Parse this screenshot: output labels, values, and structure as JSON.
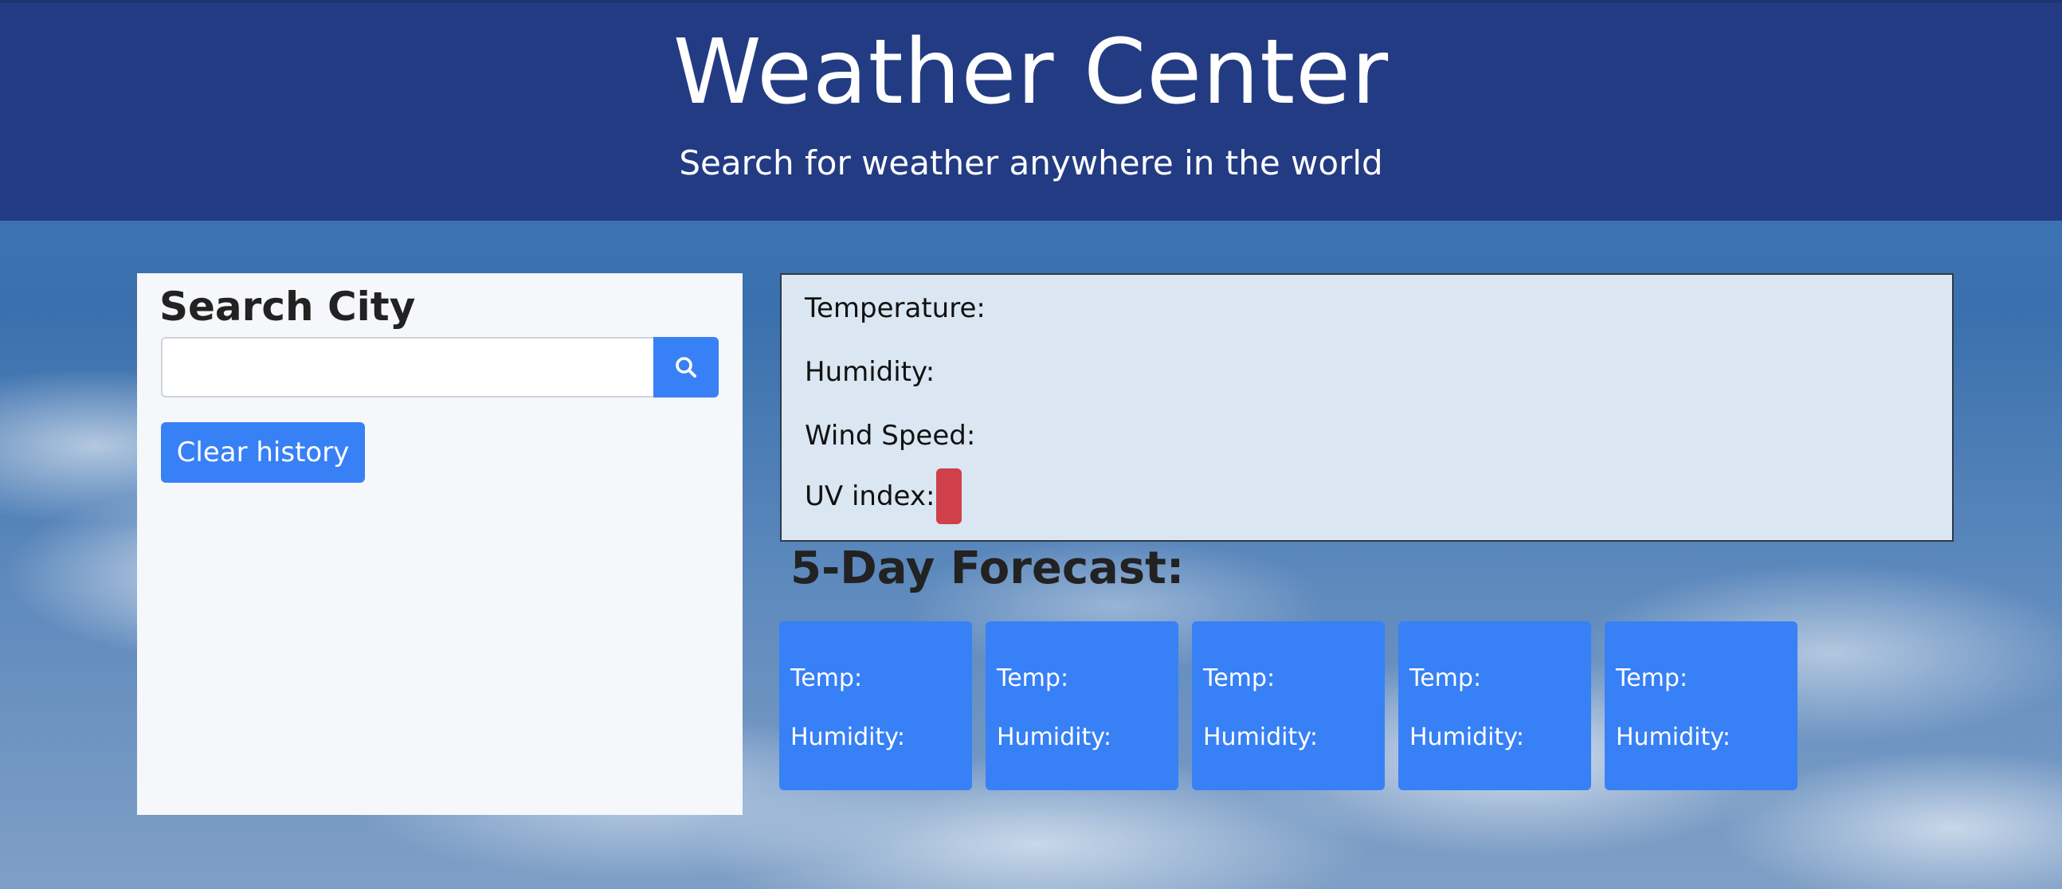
{
  "header": {
    "title": "Weather Center",
    "subtitle": "Search for weather anywhere in the world"
  },
  "search": {
    "heading": "Search City",
    "input_value": "",
    "input_placeholder": "",
    "search_icon": "search-icon",
    "clear_label": "Clear history"
  },
  "current": {
    "temperature_label": "Temperature:",
    "humidity_label": "Humidity:",
    "wind_label": "Wind Speed:",
    "uv_label": "UV index:",
    "uv_value": "",
    "uv_color": "#d0404a"
  },
  "forecast": {
    "title": "5-Day Forecast:",
    "days": [
      {
        "temp_label": "Temp:",
        "humidity_label": "Humidity:"
      },
      {
        "temp_label": "Temp:",
        "humidity_label": "Humidity:"
      },
      {
        "temp_label": "Temp:",
        "humidity_label": "Humidity:"
      },
      {
        "temp_label": "Temp:",
        "humidity_label": "Humidity:"
      },
      {
        "temp_label": "Temp:",
        "humidity_label": "Humidity:"
      }
    ]
  },
  "colors": {
    "header_bg": "#233b82",
    "accent": "#3880f5",
    "panel_bg": "#f5f7fa",
    "current_bg": "#dae6f2"
  }
}
